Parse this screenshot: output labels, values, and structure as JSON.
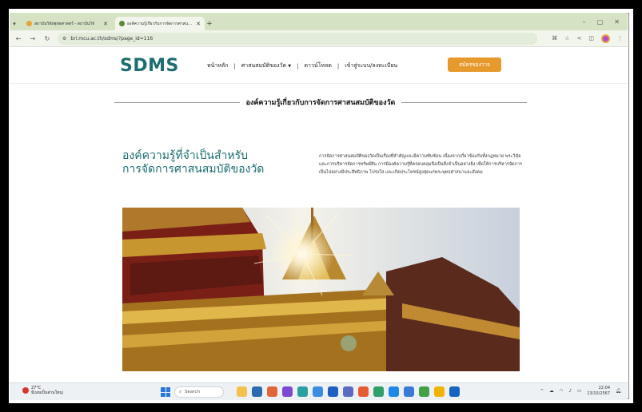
{
  "browser": {
    "tabs": [
      {
        "title": "สถาบันวิจัยพุทธศาสตร์ - สถาบันวิจั",
        "favicon_color": "#e7a23a",
        "active": false
      },
      {
        "title": "องค์ความรู้เกี่ยวกับการจัดการศาสนสมบั",
        "favicon_color": "#5b8a3a",
        "active": true
      }
    ],
    "new_tab": "+",
    "url": "bri.mcu.ac.th/sdms/?page_id=116",
    "window_controls": [
      "⌄",
      "–",
      "▢",
      "✕"
    ]
  },
  "site": {
    "logo": "SDMS",
    "menu": [
      "หน้าหลัก",
      "ศาสนสมบัติของวัด",
      "ดาวน์โหลด",
      "เข้าสู่ระบบ/ลงทะเบียน"
    ],
    "menu_separator": "|",
    "cta": "สมัครของวาจ",
    "accent": "#1d6d71",
    "cta_color": "#e69a2e"
  },
  "content": {
    "section_title": "องค์ความรู้เกี่ยวกับการจัดการศาสนสมบัติของวัด",
    "heading_line1": "องค์ความรู้ที่จำเป็นสำหรับ",
    "heading_line2": "การจัดการศาสนสมบัติของวัด",
    "description": "การจัดการศาสนสมบัติของวัดเป็นเรื่องที่สำคัญและมีความซับซ้อน เนื่องจากเกี่ยวข้องกับทั้งกฎหมาย พระวินัย และการบริหารจัดการทรัพย์สิน การมีองค์ความรู้ที่ครอบคลุมจึงเป็นสิ่งจำเป็นอย่างยิ่ง เพื่อให้การบริหารจัดการเป็นไปอย่างมีประสิทธิภาพ โปร่งใส และเกิดประโยชน์สูงสุดแก่พระพุทธศาสนาและสังคม"
  },
  "taskbar": {
    "weather_temp": "27°C",
    "weather_desc": "มีเมฆเป็นส่วนใหญ่",
    "search": "Search",
    "time": "22:04",
    "date": "13/10/2567",
    "app_colors": [
      "#f2c14e",
      "#2b6cb0",
      "#e0663a",
      "#7a4bd0",
      "#2aa0a0",
      "#3c8dde",
      "#1f5fbf",
      "#5c6bc0",
      "#e85b32",
      "#2f9f6b",
      "#1e88e5",
      "#3a7bd5",
      "#43a047",
      "#f0b400",
      "#1565c0"
    ]
  }
}
